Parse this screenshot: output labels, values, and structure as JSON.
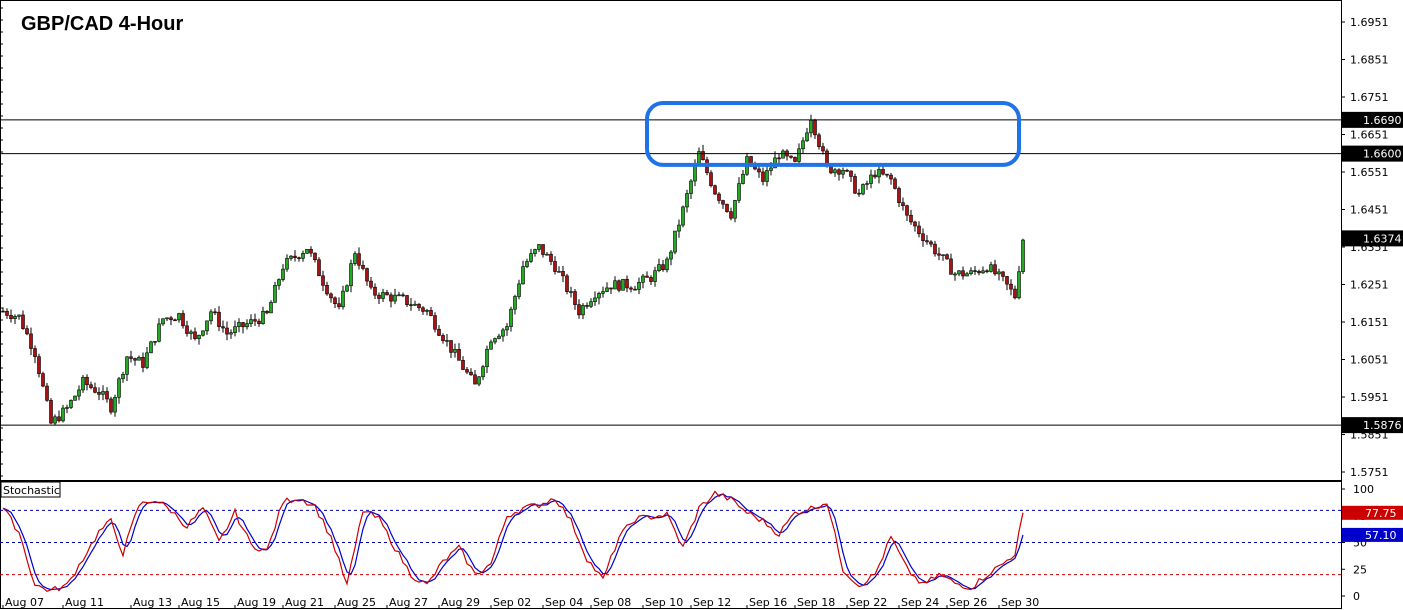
{
  "chart_data": {
    "type": "candlestick",
    "title": "GBP/CAD 4-Hour",
    "price_axis": {
      "ticks": [
        "1.6951",
        "1.6851",
        "1.6751",
        "1.6651",
        "1.6551",
        "1.6451",
        "1.6351",
        "1.6251",
        "1.6151",
        "1.6051",
        "1.5951",
        "1.5851",
        "1.5751"
      ],
      "ylim": [
        1.57,
        1.7
      ]
    },
    "levels": [
      {
        "value": 1.669,
        "label": "1.6690",
        "color": "#000000"
      },
      {
        "value": 1.66,
        "label": "1.6600",
        "color": "#000000"
      },
      {
        "value": 1.5876,
        "label": "1.5876",
        "color": "#000000"
      }
    ],
    "current_price": {
      "value": 1.6374,
      "label": "1.6374",
      "color": "#000000"
    },
    "highlight_zone": {
      "low": 1.657,
      "high": 1.6735,
      "start_index": 162,
      "end_index": 253,
      "color": "#1e73e8"
    },
    "x_axis": {
      "labels": [
        "Aug 07",
        "Aug 11",
        "Aug 13",
        "Aug 15",
        "Aug 19",
        "Aug 21",
        "Aug 25",
        "Aug 27",
        "Aug 29",
        "Sep 02",
        "Sep 04",
        "Sep 08",
        "Sep 10",
        "Sep 12",
        "Sep 16",
        "Sep 18",
        "Sep 22",
        "Sep 24",
        "Sep 26",
        "Sep 30"
      ],
      "label_indices": [
        0,
        15,
        32,
        44,
        58,
        70,
        83,
        96,
        109,
        122,
        135,
        147,
        160,
        172,
        186,
        198,
        211,
        224,
        236,
        249
      ]
    },
    "up_color": "#22aa22",
    "down_color": "#aa1111",
    "anchors": [
      [
        0,
        1.618
      ],
      [
        4,
        1.6165
      ],
      [
        8,
        1.607
      ],
      [
        12,
        1.588
      ],
      [
        16,
        1.592
      ],
      [
        20,
        1.599
      ],
      [
        24,
        1.5965
      ],
      [
        27,
        1.5925
      ],
      [
        31,
        1.606
      ],
      [
        35,
        1.604
      ],
      [
        40,
        1.616
      ],
      [
        44,
        1.617
      ],
      [
        48,
        1.61
      ],
      [
        52,
        1.618
      ],
      [
        56,
        1.612
      ],
      [
        60,
        1.614
      ],
      [
        66,
        1.617
      ],
      [
        70,
        1.63
      ],
      [
        76,
        1.635
      ],
      [
        80,
        1.626
      ],
      [
        84,
        1.618
      ],
      [
        88,
        1.634
      ],
      [
        92,
        1.623
      ],
      [
        100,
        1.621
      ],
      [
        106,
        1.618
      ],
      [
        112,
        1.608
      ],
      [
        118,
        1.598
      ],
      [
        122,
        1.611
      ],
      [
        126,
        1.614
      ],
      [
        130,
        1.63
      ],
      [
        134,
        1.635
      ],
      [
        138,
        1.63
      ],
      [
        144,
        1.618
      ],
      [
        148,
        1.623
      ],
      [
        152,
        1.625
      ],
      [
        158,
        1.625
      ],
      [
        162,
        1.627
      ],
      [
        166,
        1.631
      ],
      [
        170,
        1.645
      ],
      [
        174,
        1.66
      ],
      [
        178,
        1.65
      ],
      [
        182,
        1.644
      ],
      [
        186,
        1.658
      ],
      [
        190,
        1.653
      ],
      [
        194,
        1.66
      ],
      [
        198,
        1.657
      ],
      [
        202,
        1.67
      ],
      [
        206,
        1.656
      ],
      [
        210,
        1.656
      ],
      [
        214,
        1.649
      ],
      [
        218,
        1.655
      ],
      [
        222,
        1.653
      ],
      [
        226,
        1.643
      ],
      [
        230,
        1.638
      ],
      [
        234,
        1.633
      ],
      [
        238,
        1.628
      ],
      [
        242,
        1.628
      ],
      [
        246,
        1.63
      ],
      [
        250,
        1.626
      ],
      [
        253,
        1.622
      ],
      [
        255,
        1.6374
      ]
    ],
    "indicator": {
      "name": "Stochastic",
      "ticks": [
        "100",
        "75",
        "50",
        "25",
        "0"
      ],
      "ylim": [
        0,
        100
      ],
      "levels": [
        80,
        50,
        20
      ],
      "main_color": "#cc0000",
      "signal_color": "#0000cc",
      "main_value": {
        "value": 77.75,
        "label": "77.75",
        "color": "#cc0000"
      },
      "signal_value": {
        "value": 57.1,
        "label": "57.10",
        "color": "#0000cc"
      },
      "anchors": [
        [
          0,
          82
        ],
        [
          4,
          60
        ],
        [
          8,
          10
        ],
        [
          12,
          5
        ],
        [
          16,
          10
        ],
        [
          20,
          35
        ],
        [
          24,
          60
        ],
        [
          27,
          70
        ],
        [
          30,
          40
        ],
        [
          34,
          85
        ],
        [
          38,
          90
        ],
        [
          42,
          80
        ],
        [
          46,
          65
        ],
        [
          50,
          82
        ],
        [
          54,
          50
        ],
        [
          58,
          78
        ],
        [
          62,
          48
        ],
        [
          66,
          42
        ],
        [
          70,
          88
        ],
        [
          74,
          92
        ],
        [
          78,
          84
        ],
        [
          82,
          55
        ],
        [
          86,
          10
        ],
        [
          90,
          80
        ],
        [
          94,
          72
        ],
        [
          98,
          45
        ],
        [
          102,
          20
        ],
        [
          106,
          10
        ],
        [
          110,
          32
        ],
        [
          114,
          45
        ],
        [
          118,
          20
        ],
        [
          122,
          30
        ],
        [
          126,
          75
        ],
        [
          130,
          82
        ],
        [
          134,
          85
        ],
        [
          138,
          92
        ],
        [
          142,
          70
        ],
        [
          146,
          35
        ],
        [
          150,
          15
        ],
        [
          154,
          55
        ],
        [
          158,
          72
        ],
        [
          162,
          74
        ],
        [
          166,
          76
        ],
        [
          170,
          45
        ],
        [
          174,
          82
        ],
        [
          178,
          96
        ],
        [
          182,
          90
        ],
        [
          186,
          78
        ],
        [
          190,
          70
        ],
        [
          194,
          58
        ],
        [
          198,
          78
        ],
        [
          202,
          82
        ],
        [
          206,
          88
        ],
        [
          210,
          25
        ],
        [
          214,
          10
        ],
        [
          218,
          20
        ],
        [
          222,
          55
        ],
        [
          226,
          25
        ],
        [
          230,
          10
        ],
        [
          234,
          20
        ],
        [
          238,
          12
        ],
        [
          242,
          8
        ],
        [
          246,
          20
        ],
        [
          250,
          30
        ],
        [
          253,
          40
        ],
        [
          255,
          77.75
        ]
      ]
    }
  }
}
